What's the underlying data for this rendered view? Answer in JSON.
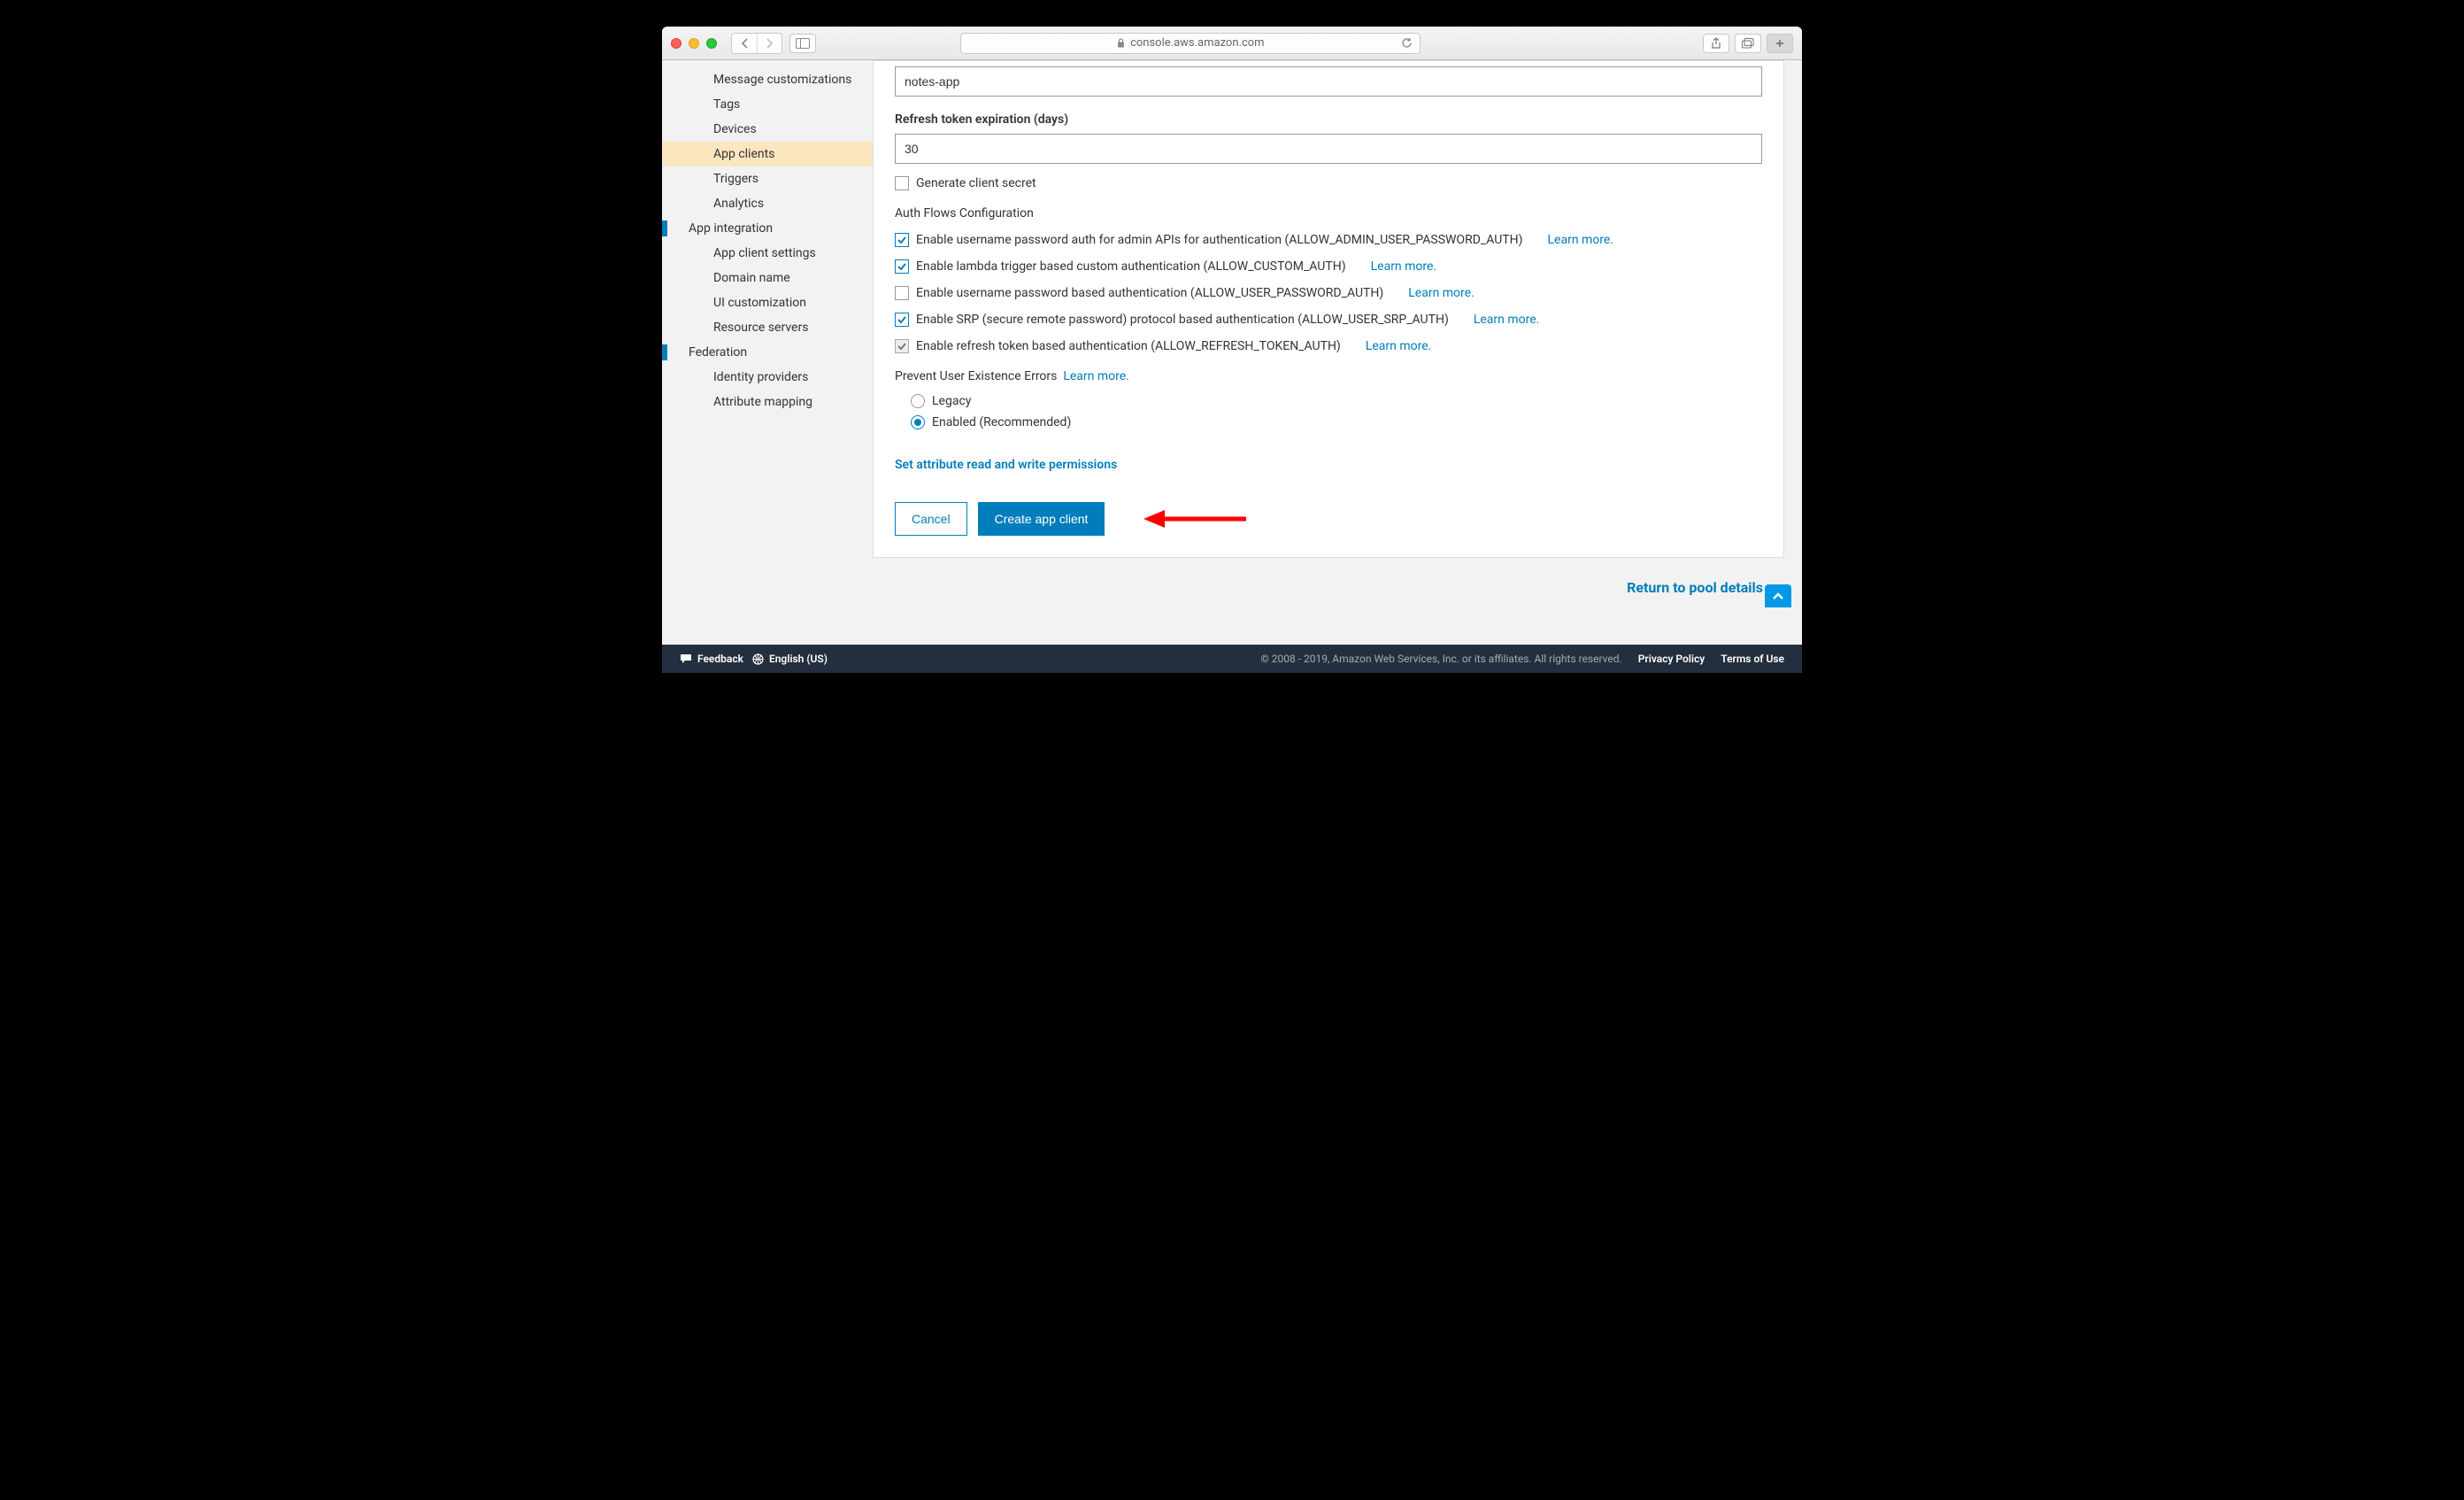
{
  "browser": {
    "url": "console.aws.amazon.com"
  },
  "sidebar": {
    "items": [
      {
        "label": "Message customizations"
      },
      {
        "label": "Tags"
      },
      {
        "label": "Devices"
      },
      {
        "label": "App clients"
      },
      {
        "label": "Triggers"
      },
      {
        "label": "Analytics"
      }
    ],
    "section2": {
      "heading": "App integration",
      "items": [
        {
          "label": "App client settings"
        },
        {
          "label": "Domain name"
        },
        {
          "label": "UI customization"
        },
        {
          "label": "Resource servers"
        }
      ]
    },
    "section3": {
      "heading": "Federation",
      "items": [
        {
          "label": "Identity providers"
        },
        {
          "label": "Attribute mapping"
        }
      ]
    }
  },
  "form": {
    "app_name_value": "notes-app",
    "refresh_label": "Refresh token expiration (days)",
    "refresh_value": "30",
    "generate_secret": "Generate client secret",
    "auth_flows_heading": "Auth Flows Configuration",
    "flows": [
      {
        "label": "Enable username password auth for admin APIs for authentication (ALLOW_ADMIN_USER_PASSWORD_AUTH)",
        "learn": "Learn more."
      },
      {
        "label": "Enable lambda trigger based custom authentication (ALLOW_CUSTOM_AUTH)",
        "learn": "Learn more."
      },
      {
        "label": "Enable username password based authentication (ALLOW_USER_PASSWORD_AUTH)",
        "learn": "Learn more."
      },
      {
        "label": "Enable SRP (secure remote password) protocol based authentication (ALLOW_USER_SRP_AUTH)",
        "learn": "Learn more."
      },
      {
        "label": "Enable refresh token based authentication (ALLOW_REFRESH_TOKEN_AUTH)",
        "learn": "Learn more."
      }
    ],
    "prevent_errors_label": "Prevent User Existence Errors",
    "prevent_errors_learn": "Learn more.",
    "radio_legacy": "Legacy",
    "radio_enabled": "Enabled (Recommended)",
    "set_permissions": "Set attribute read and write permissions",
    "cancel": "Cancel",
    "create": "Create app client"
  },
  "return_link": "Return to pool details",
  "footer": {
    "feedback": "Feedback",
    "language": "English (US)",
    "copyright": "© 2008 - 2019, Amazon Web Services, Inc. or its affiliates. All rights reserved.",
    "privacy": "Privacy Policy",
    "terms": "Terms of Use"
  }
}
